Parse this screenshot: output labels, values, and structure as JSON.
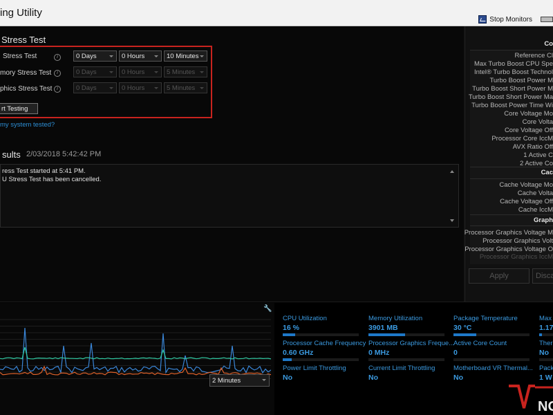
{
  "window": {
    "title": "ing Utility",
    "stop_monitors": "Stop Monitors",
    "stop_icon": "monitor-stop-icon"
  },
  "stress": {
    "title": "Stress Test",
    "rows": [
      {
        "label": "Stress Test",
        "days": "0 Days",
        "hours": "0 Hours",
        "minutes": "10 Minutes",
        "enabled": true
      },
      {
        "label": "mory Stress Test",
        "days": "0 Days",
        "hours": "0 Hours",
        "minutes": "5 Minutes",
        "enabled": false
      },
      {
        "label": "phics Stress Test",
        "days": "0 Days",
        "hours": "0 Hours",
        "minutes": "5 Minutes",
        "enabled": false
      }
    ],
    "start_button": "rt Testing",
    "why_link": "my system tested?"
  },
  "results": {
    "title": "sults",
    "timestamp": "2/03/2018 5:42:42 PM",
    "log": [
      "ress Test started at 5:41 PM.",
      "U Stress Test has been cancelled."
    ]
  },
  "side_panel": {
    "core_head": "Co",
    "core_items": [
      "Reference Cl",
      "Max Turbo Boost CPU Spe",
      "Intel® Turbo Boost Technol",
      "Turbo Boost Power M",
      "Turbo Boost Short Power M",
      "Turbo Boost Short Power Ma",
      "Turbo Boost Power Time Wi",
      "Core Voltage Mo",
      "Core Volta",
      "Core Voltage Off",
      "Processor Core IccM",
      "AVX Ratio Off",
      "1 Active C",
      "2 Active Co"
    ],
    "cache_head": "Cac",
    "cache_items": [
      "Cache Voltage Mo",
      "Cache Volta",
      "Cache Voltage Off",
      "Cache IccM"
    ],
    "graphics_head": "Graph",
    "graphics_items": [
      "Processor Graphics Voltage M",
      "Processor Graphics Volt",
      "Processor Graphics Voltage O",
      "Processor Graphics IccM"
    ],
    "apply": "Apply",
    "discard": "Disca"
  },
  "graph": {
    "range_select": "2 Minutes",
    "colors": {
      "blue": "#3a86d8",
      "teal": "#2ec7a0",
      "orange": "#e0622a"
    }
  },
  "stats": [
    {
      "label": "CPU Utilization",
      "value": "16 %",
      "fill": 0.16
    },
    {
      "label": "Memory Utilization",
      "value": "3901  MB",
      "fill": 0.48
    },
    {
      "label": "Package Temperature",
      "value": "30 °C",
      "fill": 0.3
    },
    {
      "label": "Max (",
      "value": "1.17",
      "fill": 0.2
    },
    {
      "label": "Processor Cache Frequency",
      "value": "0.60 GHz",
      "fill": 0.12
    },
    {
      "label": "Processor Graphics Freque...",
      "value": "0 MHz",
      "fill": 0
    },
    {
      "label": "Active Core Count",
      "value": "0",
      "fill": 0
    },
    {
      "label": "Therr",
      "value": "No",
      "fill": 0
    },
    {
      "label": "Power Limit Throttling",
      "value": "No",
      "fill": 0
    },
    {
      "label": "Current Limit Throttling",
      "value": "No",
      "fill": 0
    },
    {
      "label": "Motherboard VR Thermal...",
      "value": "No",
      "fill": 0
    },
    {
      "label": "Packa",
      "value": "1 W",
      "fill": 0
    }
  ],
  "watermark": {
    "text": "NO"
  }
}
